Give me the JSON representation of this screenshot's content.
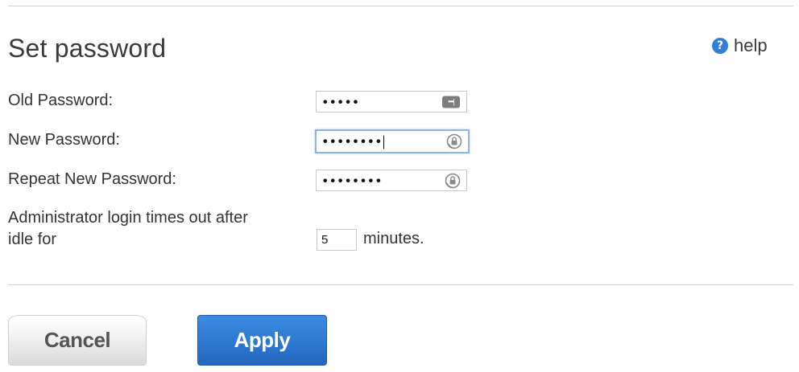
{
  "header": {
    "title": "Set password",
    "help_label": "help",
    "help_icon": "help-question-icon"
  },
  "form": {
    "old_password": {
      "label": "Old Password:",
      "masked_value": "•••••",
      "icon": "password-manager-key-icon"
    },
    "new_password": {
      "label": "New Password:",
      "masked_value": "••••••••",
      "icon": "password-lock-icon"
    },
    "repeat_password": {
      "label": "Repeat New Password:",
      "masked_value": "••••••••",
      "icon": "password-lock-icon"
    },
    "timeout": {
      "label_line1": "Administrator login times out after",
      "label_line2": "idle for",
      "value": "5",
      "unit": "minutes."
    }
  },
  "buttons": {
    "cancel": "Cancel",
    "apply": "Apply"
  },
  "colors": {
    "accent": "#2f7ed8",
    "focus_border": "#8eb4e6"
  }
}
